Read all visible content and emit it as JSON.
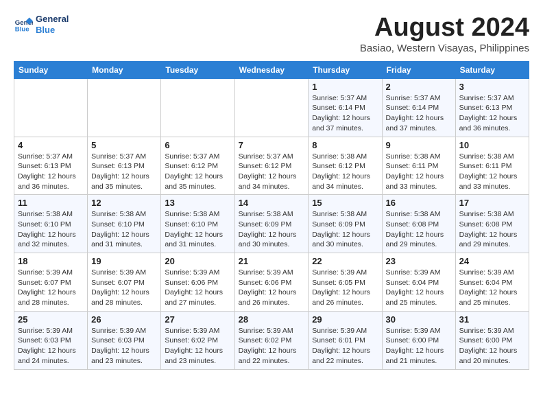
{
  "logo": {
    "line1": "General",
    "line2": "Blue"
  },
  "title": "August 2024",
  "subtitle": "Basiao, Western Visayas, Philippines",
  "days_of_week": [
    "Sunday",
    "Monday",
    "Tuesday",
    "Wednesday",
    "Thursday",
    "Friday",
    "Saturday"
  ],
  "weeks": [
    [
      {
        "day": "",
        "detail": ""
      },
      {
        "day": "",
        "detail": ""
      },
      {
        "day": "",
        "detail": ""
      },
      {
        "day": "",
        "detail": ""
      },
      {
        "day": "1",
        "detail": "Sunrise: 5:37 AM\nSunset: 6:14 PM\nDaylight: 12 hours\nand 37 minutes."
      },
      {
        "day": "2",
        "detail": "Sunrise: 5:37 AM\nSunset: 6:14 PM\nDaylight: 12 hours\nand 37 minutes."
      },
      {
        "day": "3",
        "detail": "Sunrise: 5:37 AM\nSunset: 6:13 PM\nDaylight: 12 hours\nand 36 minutes."
      }
    ],
    [
      {
        "day": "4",
        "detail": "Sunrise: 5:37 AM\nSunset: 6:13 PM\nDaylight: 12 hours\nand 36 minutes."
      },
      {
        "day": "5",
        "detail": "Sunrise: 5:37 AM\nSunset: 6:13 PM\nDaylight: 12 hours\nand 35 minutes."
      },
      {
        "day": "6",
        "detail": "Sunrise: 5:37 AM\nSunset: 6:12 PM\nDaylight: 12 hours\nand 35 minutes."
      },
      {
        "day": "7",
        "detail": "Sunrise: 5:37 AM\nSunset: 6:12 PM\nDaylight: 12 hours\nand 34 minutes."
      },
      {
        "day": "8",
        "detail": "Sunrise: 5:38 AM\nSunset: 6:12 PM\nDaylight: 12 hours\nand 34 minutes."
      },
      {
        "day": "9",
        "detail": "Sunrise: 5:38 AM\nSunset: 6:11 PM\nDaylight: 12 hours\nand 33 minutes."
      },
      {
        "day": "10",
        "detail": "Sunrise: 5:38 AM\nSunset: 6:11 PM\nDaylight: 12 hours\nand 33 minutes."
      }
    ],
    [
      {
        "day": "11",
        "detail": "Sunrise: 5:38 AM\nSunset: 6:10 PM\nDaylight: 12 hours\nand 32 minutes."
      },
      {
        "day": "12",
        "detail": "Sunrise: 5:38 AM\nSunset: 6:10 PM\nDaylight: 12 hours\nand 31 minutes."
      },
      {
        "day": "13",
        "detail": "Sunrise: 5:38 AM\nSunset: 6:10 PM\nDaylight: 12 hours\nand 31 minutes."
      },
      {
        "day": "14",
        "detail": "Sunrise: 5:38 AM\nSunset: 6:09 PM\nDaylight: 12 hours\nand 30 minutes."
      },
      {
        "day": "15",
        "detail": "Sunrise: 5:38 AM\nSunset: 6:09 PM\nDaylight: 12 hours\nand 30 minutes."
      },
      {
        "day": "16",
        "detail": "Sunrise: 5:38 AM\nSunset: 6:08 PM\nDaylight: 12 hours\nand 29 minutes."
      },
      {
        "day": "17",
        "detail": "Sunrise: 5:38 AM\nSunset: 6:08 PM\nDaylight: 12 hours\nand 29 minutes."
      }
    ],
    [
      {
        "day": "18",
        "detail": "Sunrise: 5:39 AM\nSunset: 6:07 PM\nDaylight: 12 hours\nand 28 minutes."
      },
      {
        "day": "19",
        "detail": "Sunrise: 5:39 AM\nSunset: 6:07 PM\nDaylight: 12 hours\nand 28 minutes."
      },
      {
        "day": "20",
        "detail": "Sunrise: 5:39 AM\nSunset: 6:06 PM\nDaylight: 12 hours\nand 27 minutes."
      },
      {
        "day": "21",
        "detail": "Sunrise: 5:39 AM\nSunset: 6:06 PM\nDaylight: 12 hours\nand 26 minutes."
      },
      {
        "day": "22",
        "detail": "Sunrise: 5:39 AM\nSunset: 6:05 PM\nDaylight: 12 hours\nand 26 minutes."
      },
      {
        "day": "23",
        "detail": "Sunrise: 5:39 AM\nSunset: 6:04 PM\nDaylight: 12 hours\nand 25 minutes."
      },
      {
        "day": "24",
        "detail": "Sunrise: 5:39 AM\nSunset: 6:04 PM\nDaylight: 12 hours\nand 25 minutes."
      }
    ],
    [
      {
        "day": "25",
        "detail": "Sunrise: 5:39 AM\nSunset: 6:03 PM\nDaylight: 12 hours\nand 24 minutes."
      },
      {
        "day": "26",
        "detail": "Sunrise: 5:39 AM\nSunset: 6:03 PM\nDaylight: 12 hours\nand 23 minutes."
      },
      {
        "day": "27",
        "detail": "Sunrise: 5:39 AM\nSunset: 6:02 PM\nDaylight: 12 hours\nand 23 minutes."
      },
      {
        "day": "28",
        "detail": "Sunrise: 5:39 AM\nSunset: 6:02 PM\nDaylight: 12 hours\nand 22 minutes."
      },
      {
        "day": "29",
        "detail": "Sunrise: 5:39 AM\nSunset: 6:01 PM\nDaylight: 12 hours\nand 22 minutes."
      },
      {
        "day": "30",
        "detail": "Sunrise: 5:39 AM\nSunset: 6:00 PM\nDaylight: 12 hours\nand 21 minutes."
      },
      {
        "day": "31",
        "detail": "Sunrise: 5:39 AM\nSunset: 6:00 PM\nDaylight: 12 hours\nand 20 minutes."
      }
    ]
  ]
}
